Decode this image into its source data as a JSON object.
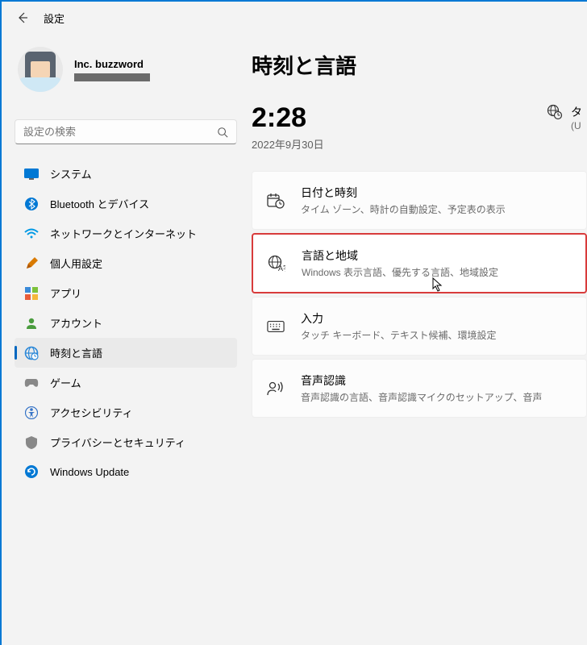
{
  "header": {
    "title": "設定"
  },
  "profile": {
    "name": "Inc. buzzword"
  },
  "search": {
    "placeholder": "設定の検索"
  },
  "nav": [
    {
      "label": "システム"
    },
    {
      "label": "Bluetooth とデバイス"
    },
    {
      "label": "ネットワークとインターネット"
    },
    {
      "label": "個人用設定"
    },
    {
      "label": "アプリ"
    },
    {
      "label": "アカウント"
    },
    {
      "label": "時刻と言語"
    },
    {
      "label": "ゲーム"
    },
    {
      "label": "アクセシビリティ"
    },
    {
      "label": "プライバシーとセキュリティ"
    },
    {
      "label": "Windows Update"
    }
  ],
  "page": {
    "title": "時刻と言語"
  },
  "clock": {
    "time": "2:28",
    "date": "2022年9月30日"
  },
  "tz": {
    "label": "タ",
    "sub": "(U"
  },
  "cards": [
    {
      "title": "日付と時刻",
      "desc": "タイム ゾーン、時計の自動設定、予定表の表示"
    },
    {
      "title": "言語と地域",
      "desc": "Windows 表示言語、優先する言語、地域設定"
    },
    {
      "title": "入力",
      "desc": "タッチ キーボード、テキスト候補、環境設定"
    },
    {
      "title": "音声認識",
      "desc": "音声認識の言語、音声認識マイクのセットアップ、音声"
    }
  ]
}
